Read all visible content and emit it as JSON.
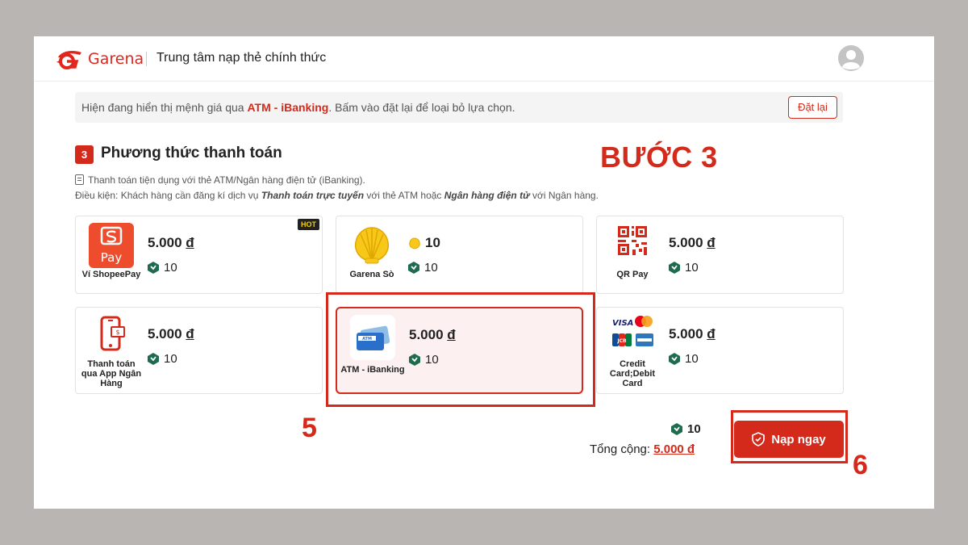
{
  "header": {
    "brand": "Garena",
    "title": "Trung tâm nạp thẻ chính thức"
  },
  "notice": {
    "prefix": "Hiện đang hiển thị mệnh giá qua ",
    "highlight": "ATM - iBanking",
    "suffix": ". Bấm vào đặt lại để loại bỏ lựa chọn.",
    "reset_label": "Đặt lại"
  },
  "section": {
    "step_number": "3",
    "title": "Phương thức thanh toán",
    "desc_line1": "Thanh toán tiện dụng với thẻ ATM/Ngân hàng điện tử (iBanking).",
    "desc_line2_a": "Điều kiện: Khách hàng cần đăng kí dịch vụ ",
    "desc_line2_b": "Thanh toán trực tuyến",
    "desc_line2_c": " với thẻ ATM hoặc ",
    "desc_line2_d": "Ngân hàng điện tử",
    "desc_line2_e": " với Ngân hàng."
  },
  "annotations": {
    "step_label": "BƯỚC 3",
    "num_5": "5",
    "num_6": "6"
  },
  "methods": [
    {
      "name": "Ví ShopeePay",
      "price": "5.000",
      "currency": "đ",
      "bonus": "10",
      "hot": "HOT",
      "icon": "shopeepay-icon"
    },
    {
      "name": "Garena Sò",
      "price": "10",
      "currency": "",
      "bonus": "10",
      "icon": "shell-icon"
    },
    {
      "name": "QR Pay",
      "price": "5.000",
      "currency": "đ",
      "bonus": "10",
      "icon": "qr-code-icon"
    },
    {
      "name": "Thanh toán qua App Ngân Hàng",
      "price": "5.000",
      "currency": "đ",
      "bonus": "10",
      "icon": "bank-app-icon"
    },
    {
      "name": "ATM - iBanking",
      "price": "5.000",
      "currency": "đ",
      "bonus": "10",
      "icon": "atm-card-icon",
      "selected": true
    },
    {
      "name": "Credit Card;Debit Card",
      "price": "5.000",
      "currency": "đ",
      "bonus": "10",
      "icon": "credit-card-icon"
    }
  ],
  "summary": {
    "bonus": "10",
    "total_label": "Tổng cộng: ",
    "total_amount": "5.000 đ"
  },
  "pay_button": {
    "label": "Nạp ngay"
  },
  "colors": {
    "accent": "#d42a1b",
    "selected_bg": "#fdf0f0",
    "gem": "#1f6b4f"
  }
}
